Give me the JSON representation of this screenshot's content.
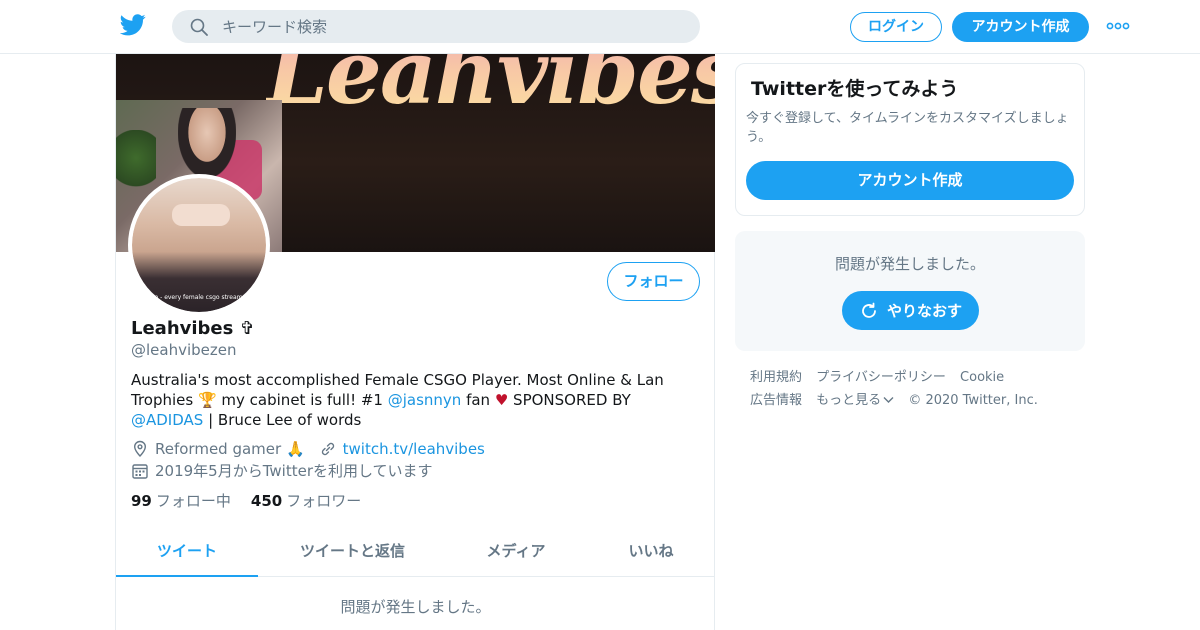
{
  "header": {
    "search_placeholder": "キーワード検索",
    "login_label": "ログイン",
    "signup_label": "アカウント作成"
  },
  "profile": {
    "banner_text": "Leahvibes",
    "avatar_caption": "Me - every female csgo streamer",
    "follow_label": "フォロー",
    "name": "Leahvibes ✞",
    "handle": "@leahvibezen",
    "bio": {
      "part1": "Australia's most accomplished Female CSGO Player. Most Online & Lan Trophies 🏆 my cabinet is full! #1 ",
      "mention1": "@jasnnyn",
      "part2": " fan ",
      "heart": "♥",
      "part3": " SPONSORED BY ",
      "mention2": "@ADIDAS",
      "part4": " | Bruce Lee of words"
    },
    "location": "Reformed gamer 🙏",
    "website": "twitch.tv/leahvibes",
    "joined": "2019年5月からTwitterを利用しています",
    "following_count": "99",
    "following_label": "フォロー中",
    "followers_count": "450",
    "followers_label": "フォロワー"
  },
  "tabs": [
    {
      "label": "ツイート",
      "active": true
    },
    {
      "label": "ツイートと返信",
      "active": false
    },
    {
      "label": "メディア",
      "active": false
    },
    {
      "label": "いいね",
      "active": false
    }
  ],
  "main_error": "問題が発生しました。",
  "sidebar": {
    "signup_card": {
      "title": "Twitterを使ってみよう",
      "description": "今すぐ登録して、タイムラインをカスタマイズしましょう。",
      "button_label": "アカウント作成"
    },
    "error_card": {
      "message": "問題が発生しました。",
      "retry_label": "やりなおす"
    },
    "footer": {
      "terms": "利用規約",
      "privacy": "プライバシーポリシー",
      "cookie": "Cookie",
      "ads": "広告情報",
      "more": "もっと見る",
      "copyright": "© 2020 Twitter, Inc."
    }
  },
  "colors": {
    "accent": "#1da1f2",
    "link": "#1b95e0",
    "muted_text": "#657786",
    "border": "#e6ecf0"
  },
  "icons": [
    "twitter-bird-icon",
    "search-icon",
    "more-dots-icon",
    "location-pin-icon",
    "link-icon",
    "calendar-icon",
    "refresh-icon",
    "chevron-down-icon"
  ]
}
